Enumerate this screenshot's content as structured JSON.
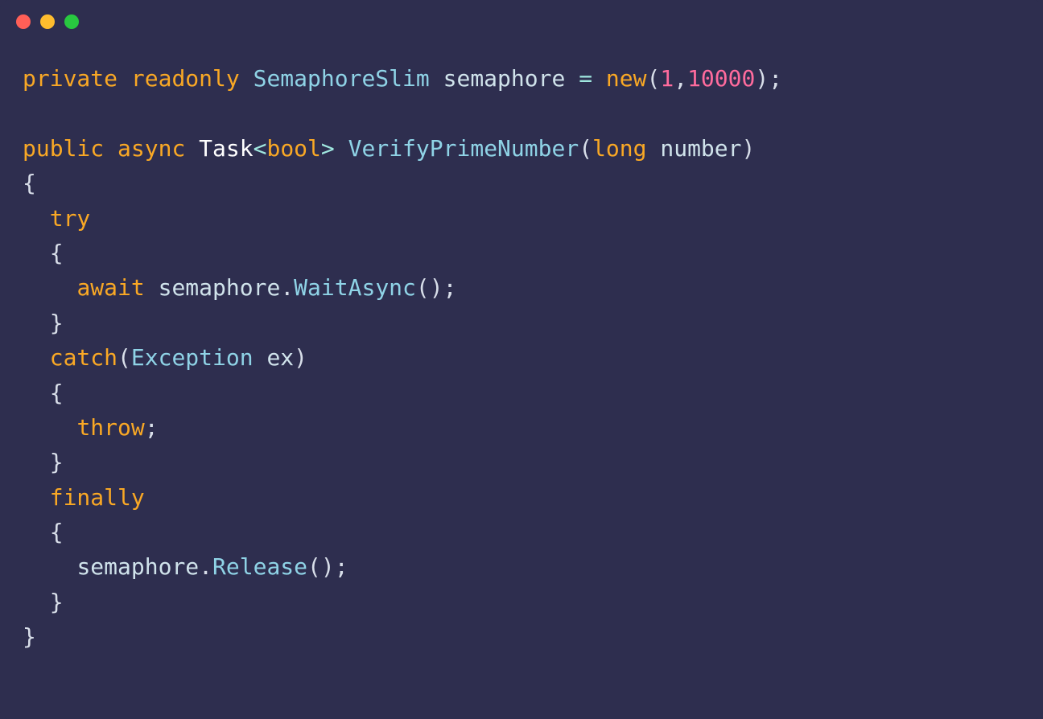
{
  "code": {
    "l1": {
      "kw_private": "private",
      "kw_readonly": "readonly",
      "type_semaphore": "SemaphoreSlim",
      "var_semaphore": "semaphore",
      "op_eq": "=",
      "kw_new": "new",
      "paren_open": "(",
      "num_1": "1",
      "comma": ",",
      "num_10000": "10000",
      "paren_close": ")",
      "semi": ";"
    },
    "l2": {
      "kw_public": "public",
      "kw_async": "async",
      "type_task": "Task",
      "angle_open": "<",
      "type_bool": "bool",
      "angle_close": ">",
      "method_name": "VerifyPrimeNumber",
      "paren_open": "(",
      "type_long": "long",
      "param_number": "number",
      "paren_close": ")"
    },
    "l3": {
      "brace_open": "{"
    },
    "l4": {
      "kw_try": "try"
    },
    "l5": {
      "brace_open": "{"
    },
    "l6": {
      "kw_await": "await",
      "var_semaphore": "semaphore",
      "dot": ".",
      "method_wait": "WaitAsync",
      "paren_open": "(",
      "paren_close": ")",
      "semi": ";"
    },
    "l7": {
      "brace_close": "}"
    },
    "l8": {
      "kw_catch": "catch",
      "paren_open": "(",
      "type_exception": "Exception",
      "var_ex": "ex",
      "paren_close": ")"
    },
    "l9": {
      "brace_open": "{"
    },
    "l10": {
      "kw_throw": "throw",
      "semi": ";"
    },
    "l11": {
      "brace_close": "}"
    },
    "l12": {
      "kw_finally": "finally"
    },
    "l13": {
      "brace_open": "{"
    },
    "l14": {
      "var_semaphore": "semaphore",
      "dot": ".",
      "method_release": "Release",
      "paren_open": "(",
      "paren_close": ")",
      "semi": ";"
    },
    "l15": {
      "brace_close": "}"
    },
    "l16": {
      "brace_close": "}"
    }
  }
}
